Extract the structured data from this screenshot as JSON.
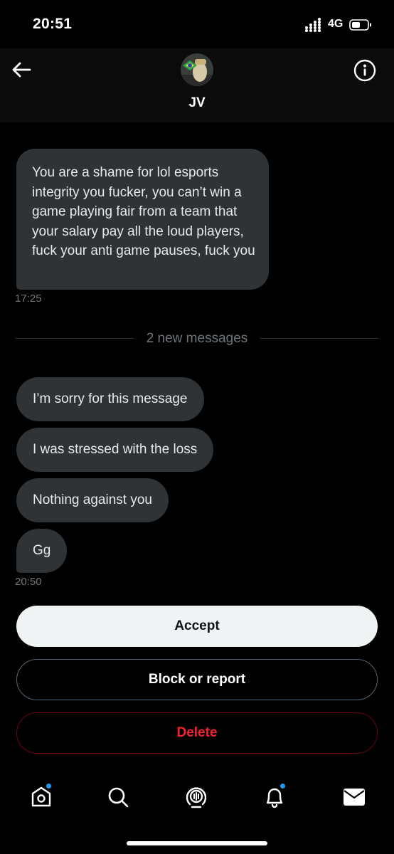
{
  "status_bar": {
    "time": "20:51",
    "network": "4G"
  },
  "header": {
    "back_icon": "arrow-left-icon",
    "title": "JV",
    "info_icon": "info-icon"
  },
  "conversation": {
    "messages": [
      {
        "text": "You are a shame for lol esports integrity you fucker, you can’t win a game playing fair from a team that your salary pay all the loud players, fuck your anti game pauses, fuck you"
      }
    ],
    "first_timestamp": "17:25",
    "new_messages_label": "2 new messages",
    "new_messages": [
      {
        "text": "I’m sorry for this message"
      },
      {
        "text": "I was stressed with the loss"
      },
      {
        "text": "Nothing against you"
      },
      {
        "text": "Gg"
      }
    ],
    "last_timestamp": "20:50"
  },
  "actions": {
    "accept_label": "Accept",
    "block_label": "Block or report",
    "delete_label": "Delete"
  },
  "bottom_nav": {
    "items": [
      {
        "icon": "home-icon",
        "has_notification": true
      },
      {
        "icon": "search-icon",
        "has_notification": false
      },
      {
        "icon": "spaces-icon",
        "has_notification": false
      },
      {
        "icon": "bell-icon",
        "has_notification": true
      },
      {
        "icon": "mail-icon",
        "has_notification": false
      }
    ]
  },
  "colors": {
    "background": "#000000",
    "bubble": "#2f3336",
    "accent_blue": "#1d9bf0",
    "delete_red": "#f4212e",
    "muted_text": "#71767b"
  }
}
